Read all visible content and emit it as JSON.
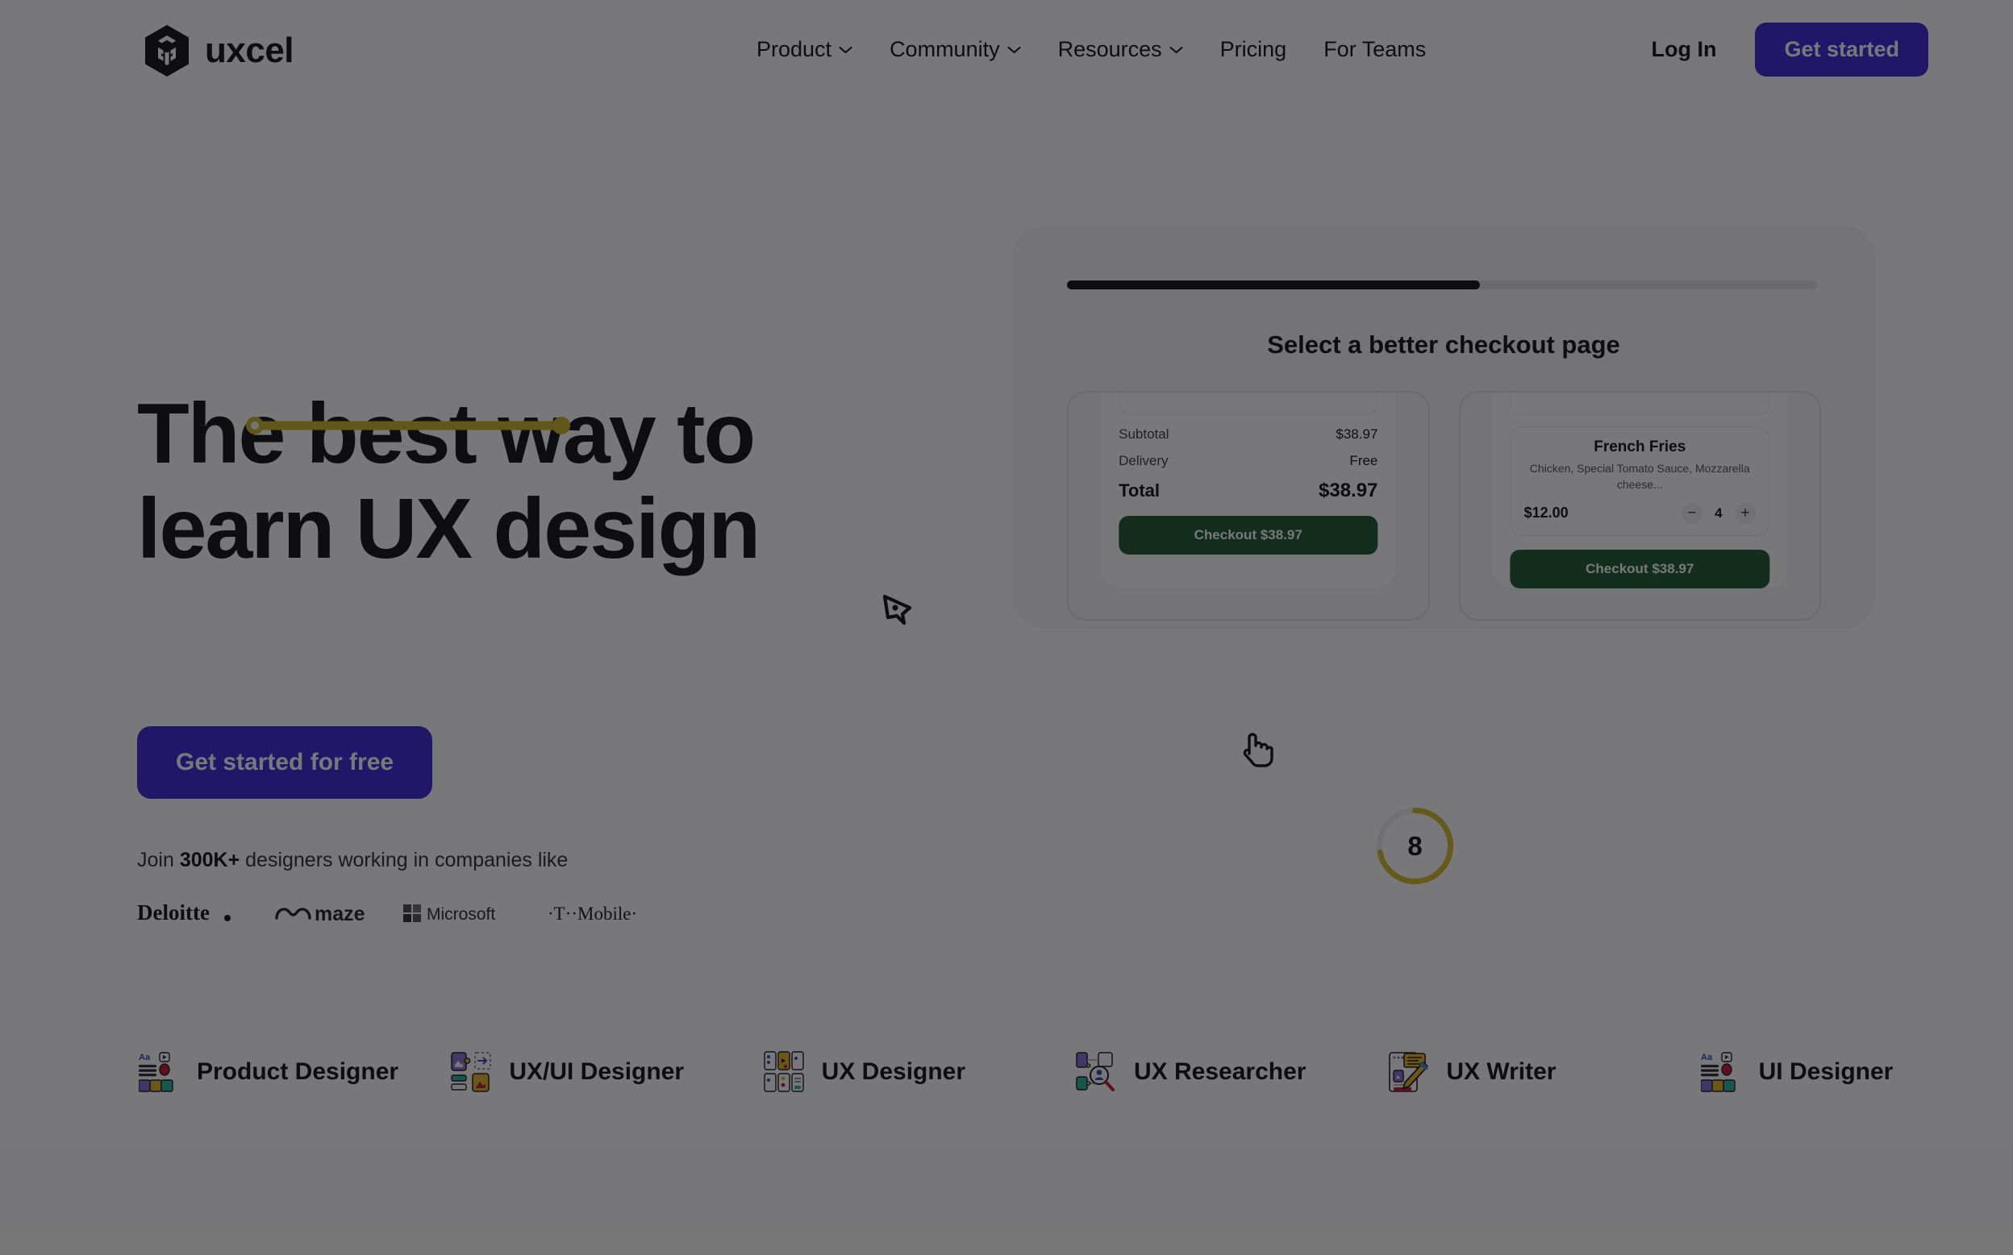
{
  "brand": {
    "name": "uxcel",
    "logo_icon": "uxcel-cube-logo",
    "accent": "#4026d9",
    "highlight": "#d4b92a",
    "dark": "#12121a"
  },
  "nav": {
    "items": [
      {
        "label": "Product",
        "has_dropdown": true,
        "icon": "chevron-down-icon"
      },
      {
        "label": "Community",
        "has_dropdown": true,
        "icon": "chevron-down-icon"
      },
      {
        "label": "Resources",
        "has_dropdown": true,
        "icon": "chevron-down-icon"
      },
      {
        "label": "Pricing",
        "has_dropdown": false
      },
      {
        "label": "For Teams",
        "has_dropdown": false
      }
    ],
    "login_label": "Log In",
    "get_started_label": "Get started"
  },
  "hero": {
    "headline_line1": "The best way to",
    "headline_line2": "learn  UX design",
    "underline_icon": "vector-path-handle",
    "cta_label": "Get started for free",
    "join_prefix": "Join ",
    "join_count": "300K+",
    "join_suffix": " designers working in companies like",
    "company_logos": [
      {
        "name": "Deloitte",
        "icon": "deloitte-logo"
      },
      {
        "name": "maze",
        "icon": "maze-logo"
      },
      {
        "name": "Microsoft",
        "icon": "microsoft-logo"
      },
      {
        "name": "T-Mobile",
        "icon": "tmobile-logo"
      }
    ]
  },
  "quiz": {
    "progress_percent": 55,
    "title": "Select a better checkout page",
    "timer_value": "8",
    "timer_percent": 72,
    "cursor_icons": [
      "pen-tool-cursor",
      "pointing-hand-cursor"
    ],
    "options": [
      {
        "id": "option-a",
        "summary_rows": [
          {
            "label": "Subtotal",
            "value": "$38.97"
          },
          {
            "label": "Delivery",
            "value": "Free"
          }
        ],
        "total_label": "Total",
        "total_value": "$38.97",
        "checkout_label": "Checkout $38.97",
        "selected": true
      },
      {
        "id": "option-b",
        "item_title": "French Fries",
        "item_desc": "Chicken, Special Tomato Sauce, Mozzarella cheese...",
        "item_price": "$12.00",
        "quantity": "4",
        "decrement_icon": "minus-icon",
        "increment_icon": "plus-icon",
        "checkout_label": "Checkout $38.97",
        "selected": false
      }
    ]
  },
  "roles": [
    {
      "label": "Product Designer",
      "icon": "product-designer-icon"
    },
    {
      "label": "UX/UI Designer",
      "icon": "ux-ui-designer-icon"
    },
    {
      "label": "UX Designer",
      "icon": "ux-designer-icon"
    },
    {
      "label": "UX Researcher",
      "icon": "ux-researcher-icon"
    },
    {
      "label": "UX Writer",
      "icon": "ux-writer-icon"
    },
    {
      "label": "UI Designer",
      "icon": "ui-designer-icon"
    }
  ]
}
